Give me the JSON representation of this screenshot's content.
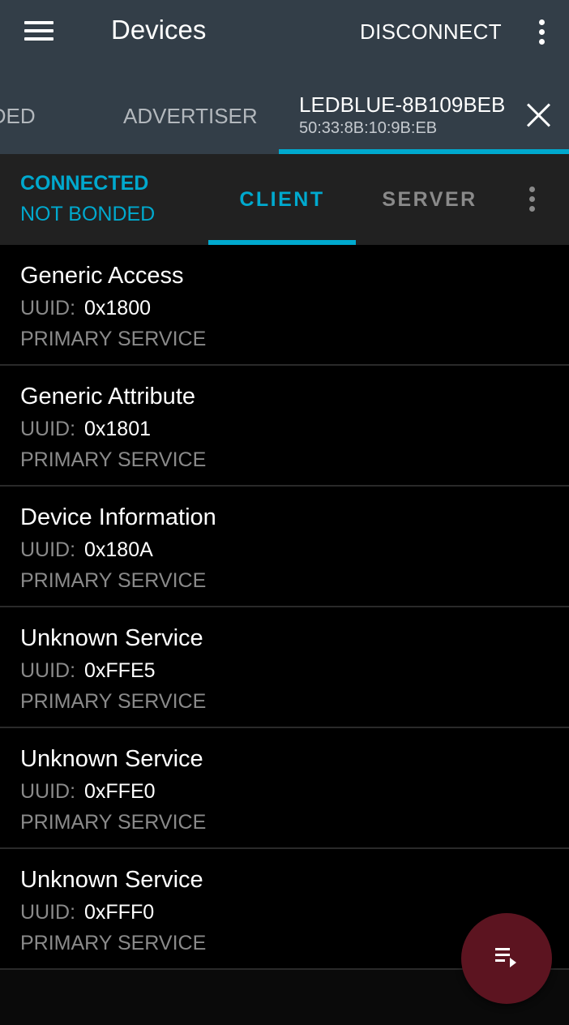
{
  "appbar": {
    "title": "Devices",
    "disconnect_label": "DISCONNECT",
    "menu_icon": "hamburger-menu-icon",
    "overflow_icon": "more-vert-icon"
  },
  "device_tabs": [
    {
      "label": "BONDED",
      "visible_text": "NDED",
      "selected": false
    },
    {
      "label": "ADVERTISER",
      "selected": false
    },
    {
      "label": "LEDBLUE-8B109BEB",
      "subtitle": "50:33:8B:10:9B:EB",
      "selected": true
    }
  ],
  "connection": {
    "state": "CONNECTED",
    "bond_state": "NOT BONDED",
    "tabs": [
      {
        "label": "CLIENT",
        "selected": true
      },
      {
        "label": "SERVER",
        "selected": false
      }
    ]
  },
  "services": [
    {
      "name": "Generic Access",
      "uuid_label": "UUID:",
      "uuid": "0x1800",
      "type": "PRIMARY SERVICE"
    },
    {
      "name": "Generic Attribute",
      "uuid_label": "UUID:",
      "uuid": "0x1801",
      "type": "PRIMARY SERVICE"
    },
    {
      "name": "Device Information",
      "uuid_label": "UUID:",
      "uuid": "0x180A",
      "type": "PRIMARY SERVICE"
    },
    {
      "name": "Unknown Service",
      "uuid_label": "UUID:",
      "uuid": "0xFFE5",
      "type": "PRIMARY SERVICE"
    },
    {
      "name": "Unknown Service",
      "uuid_label": "UUID:",
      "uuid": "0xFFE0",
      "type": "PRIMARY SERVICE"
    },
    {
      "name": "Unknown Service",
      "uuid_label": "UUID:",
      "uuid": "0xFFF0",
      "type": "PRIMARY SERVICE"
    }
  ],
  "fab": {
    "icon": "playlist-play-icon"
  },
  "colors": {
    "appbar_bg": "#333e48",
    "accent": "#00a9ce",
    "connbar_bg": "#212121",
    "fab_bg": "#5c1420"
  }
}
